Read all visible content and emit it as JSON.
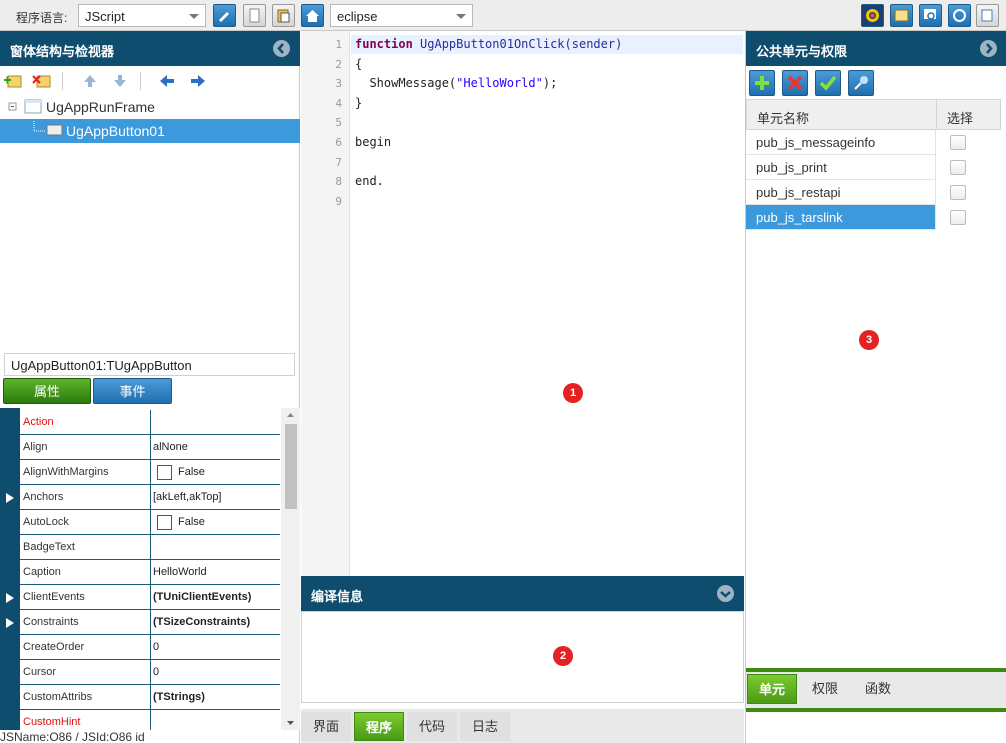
{
  "toolbar": {
    "lang_label": "程序语言:",
    "lang_value": "JScript",
    "theme_value": "eclipse"
  },
  "left": {
    "header": "窗体结构与检视器",
    "tree": [
      {
        "label": "UgAppRunFrame"
      },
      {
        "label": "UgAppButton01"
      }
    ],
    "object_name": "UgAppButton01:TUgAppButton",
    "tabs": {
      "props": "属性",
      "events": "事件"
    },
    "properties": [
      {
        "name": "Action",
        "value": "",
        "red": true
      },
      {
        "name": "Align",
        "value": "alNone"
      },
      {
        "name": "AlignWithMargins",
        "value": "False",
        "checkbox": true
      },
      {
        "name": "Anchors",
        "value": "[akLeft,akTop]",
        "expand": true
      },
      {
        "name": "AutoLock",
        "value": "False",
        "checkbox": true
      },
      {
        "name": "BadgeText",
        "value": ""
      },
      {
        "name": "Caption",
        "value": "HelloWorld"
      },
      {
        "name": "ClientEvents",
        "value": "(TUniClientEvents)",
        "bold": true,
        "expand": true
      },
      {
        "name": "Constraints",
        "value": "(TSizeConstraints)",
        "bold": true,
        "expand": true
      },
      {
        "name": "CreateOrder",
        "value": "0"
      },
      {
        "name": "Cursor",
        "value": "0"
      },
      {
        "name": "CustomAttribs",
        "value": "(TStrings)",
        "bold": true
      },
      {
        "name": "CustomHint",
        "value": "",
        "red": true
      }
    ],
    "status": "JSName:O86 / JSId:O86  id"
  },
  "editor": {
    "line_numbers": [
      "1",
      "2",
      "3",
      "4",
      "5",
      "6",
      "7",
      "8",
      "9"
    ],
    "lines": [
      {
        "kw": "function",
        "fn": "UgAppButton01OnClick(sender)"
      },
      {
        "text": "{"
      },
      {
        "pre": "  ShowMessage(",
        "str": "\"HelloWorld\"",
        "post": ");"
      },
      {
        "text": "}"
      },
      {
        "text": ""
      },
      {
        "text": "begin"
      },
      {
        "text": ""
      },
      {
        "text": "end."
      },
      {
        "text": ""
      }
    ],
    "compile_header": "编译信息",
    "bottom_tabs": [
      "界面",
      "程序",
      "代码",
      "日志"
    ],
    "active_tab": 1
  },
  "right": {
    "header": "公共单元与权限",
    "columns": [
      "单元名称",
      "选择"
    ],
    "rows": [
      {
        "name": "pub_js_messageinfo"
      },
      {
        "name": "pub_js_print"
      },
      {
        "name": "pub_js_restapi"
      },
      {
        "name": "pub_js_tarslink",
        "selected": true
      }
    ],
    "tabs": [
      "单元",
      "权限",
      "函数"
    ],
    "active_tab": 0
  },
  "markers": [
    "1",
    "2",
    "3"
  ]
}
